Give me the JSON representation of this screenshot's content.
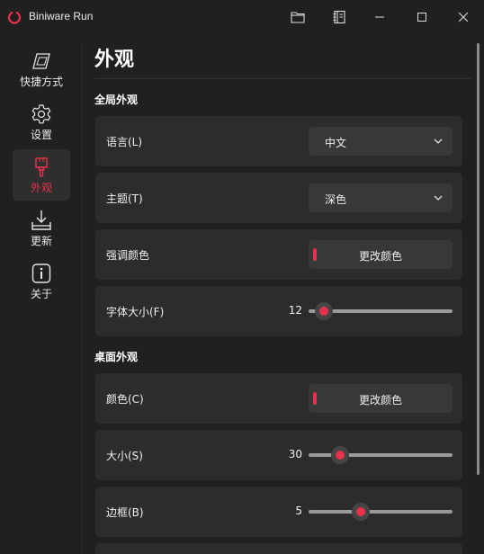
{
  "app": {
    "title": "Biniware Run",
    "accent_color": "#e8324d",
    "buttons": [
      "folder-icon",
      "notebook-icon",
      "minimize-icon",
      "maximize-icon",
      "close-icon"
    ]
  },
  "sidebar": {
    "items": [
      {
        "label": "快捷方式",
        "icon": "shortcut-icon",
        "active": false
      },
      {
        "label": "设置",
        "icon": "gear-icon",
        "active": false
      },
      {
        "label": "外观",
        "icon": "brush-icon",
        "active": true
      },
      {
        "label": "更新",
        "icon": "download-icon",
        "active": false
      },
      {
        "label": "关于",
        "icon": "info-icon",
        "active": false
      }
    ]
  },
  "main": {
    "title": "外观",
    "global_section": "全局外观",
    "desktop_section": "桌面外观",
    "language": {
      "label": "语言(L)",
      "value": "中文"
    },
    "theme": {
      "label": "主题(T)",
      "value": "深色"
    },
    "accent": {
      "label": "强调颜色",
      "button": "更改颜色"
    },
    "font_size": {
      "label": "字体大小(F)",
      "value": "12",
      "level": 0.05
    },
    "desktop_color": {
      "label": "颜色(C)",
      "button": "更改颜色"
    },
    "desktop_size": {
      "label": "大小(S)",
      "value": "30",
      "level": 0.18
    },
    "desktop_border": {
      "label": "边框(B)",
      "value": "5",
      "level": 0.34
    }
  }
}
